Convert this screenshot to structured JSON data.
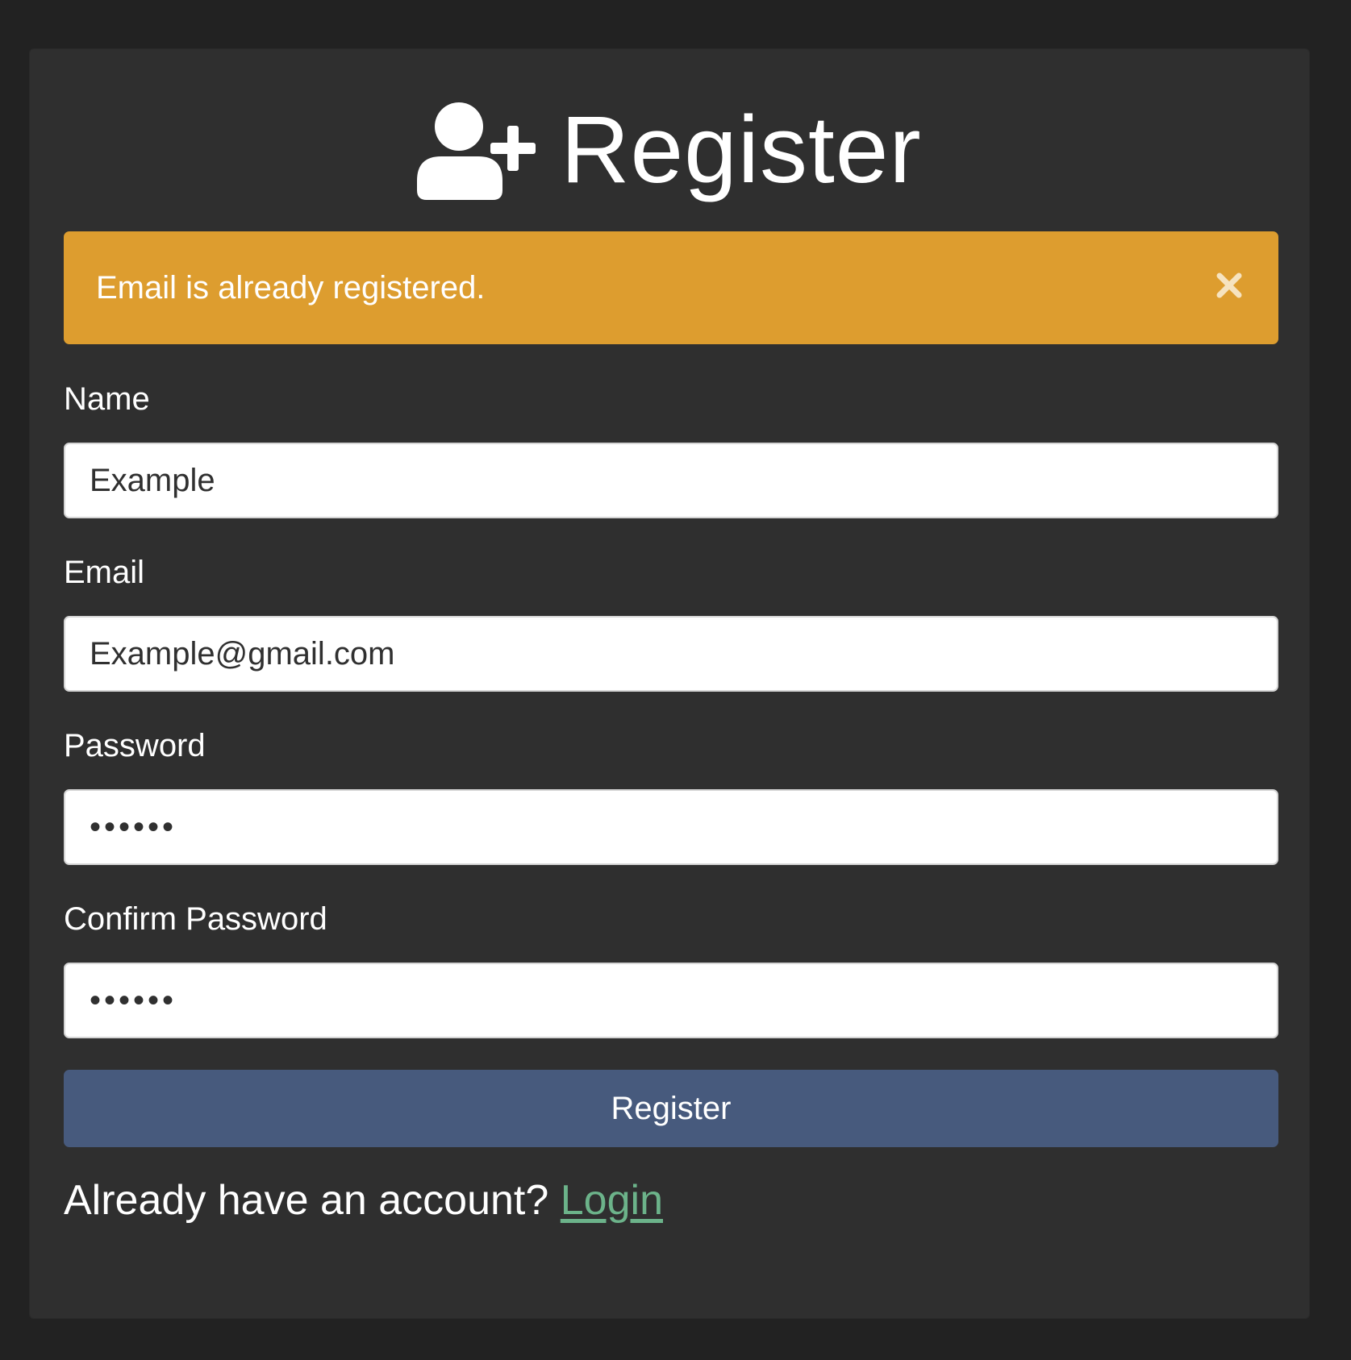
{
  "page": {
    "title": "Register",
    "title_icon": "user-plus-icon"
  },
  "alert": {
    "message": "Email is already registered.",
    "close_icon": "close-icon",
    "color": "#dd9d2f"
  },
  "form": {
    "name": {
      "label": "Name",
      "value": "Example"
    },
    "email": {
      "label": "Email",
      "value": "Example@gmail.com"
    },
    "password": {
      "label": "Password",
      "value": "••••••"
    },
    "confirm_password": {
      "label": "Confirm Password",
      "value": "••••••"
    },
    "submit_label": "Register",
    "submit_color": "#475a7d"
  },
  "footer": {
    "prompt": "Already have an account?",
    "link_label": "Login",
    "link_color": "#6cb38a"
  }
}
